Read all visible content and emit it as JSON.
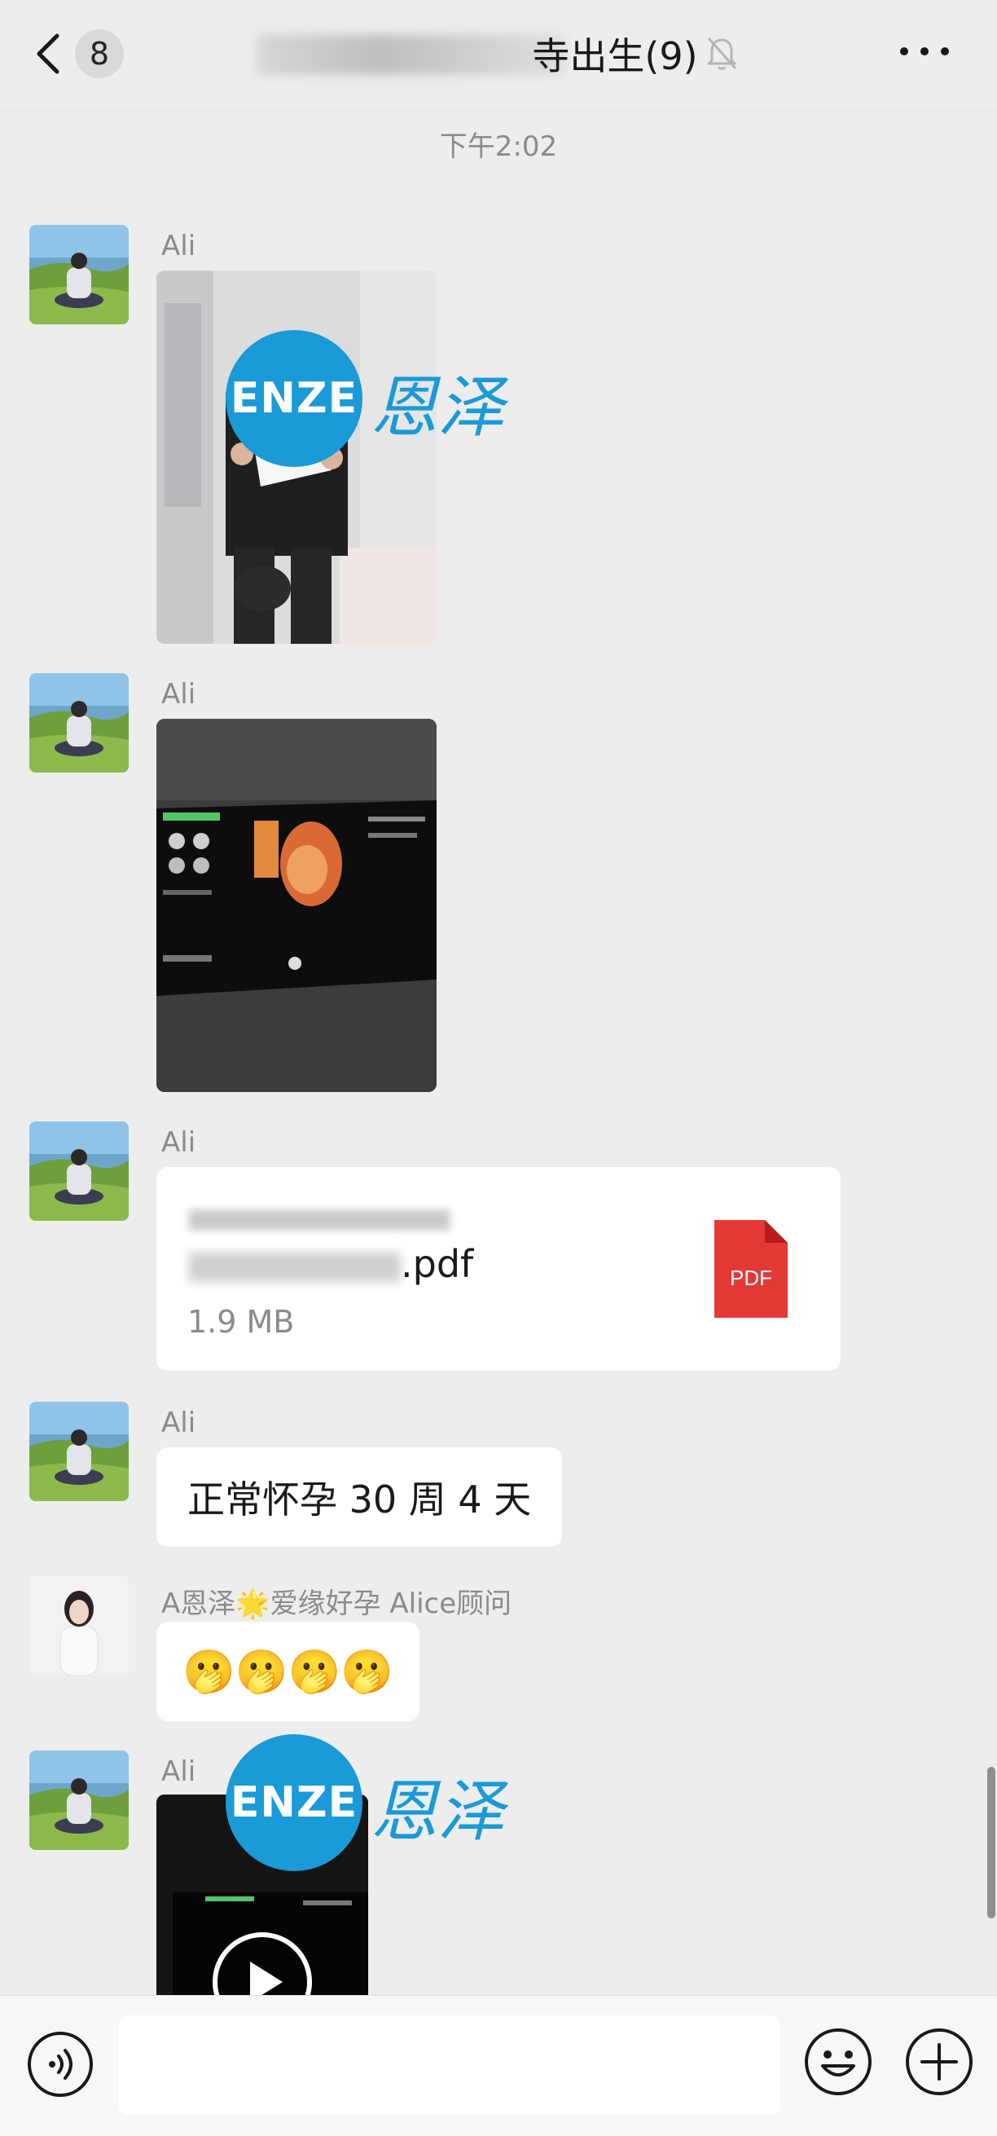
{
  "header": {
    "back_count": "8",
    "title_visible": "寺出生(9)",
    "mute_icon": "bell-off-icon",
    "more_icon": "more-dots-icon"
  },
  "timestamp": "下午2:02",
  "messages": [
    {
      "sender": "Ali",
      "type": "image"
    },
    {
      "sender": "Ali",
      "type": "image"
    },
    {
      "sender": "Ali",
      "type": "file",
      "file_name_visible": ".pdf",
      "file_size": "1.9 MB",
      "file_type": "PDF"
    },
    {
      "sender": "Ali",
      "type": "text",
      "text": "正常怀孕 30 周 4 天"
    },
    {
      "sender": "A恩泽🌟爱缘好孕 Alice顾问",
      "type": "emoji",
      "text": "🫢🫢🫢🫢"
    },
    {
      "sender": "Ali",
      "type": "video"
    }
  ],
  "watermark": {
    "logo": "ENZE",
    "text": "恩泽"
  },
  "input": {
    "placeholder": ""
  },
  "colors": {
    "background": "#ededed",
    "bubble": "#ffffff",
    "watermark": "#1a9ad6",
    "pdf": "#e53935"
  }
}
